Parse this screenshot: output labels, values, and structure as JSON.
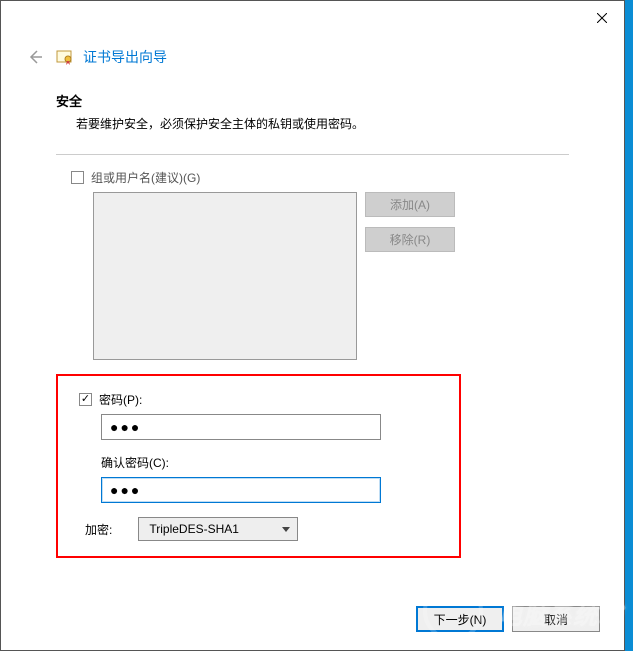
{
  "window": {
    "wizard_title": "证书导出向导"
  },
  "security": {
    "title": "安全",
    "description": "若要维护安全，必须保护安全主体的私钥或使用密码。"
  },
  "group": {
    "checkbox_label": "组或用户名(建议)(G)",
    "add_btn": "添加(A)",
    "remove_btn": "移除(R)"
  },
  "password": {
    "checkbox_label": "密码(P):",
    "value": "●●●",
    "confirm_label": "确认密码(C):",
    "confirm_value": "●●●"
  },
  "encryption": {
    "label": "加密:",
    "selected": "TripleDES-SHA1"
  },
  "footer": {
    "next": "下一步(N)",
    "cancel": "取消"
  },
  "watermark": {
    "text": "电脑系统城"
  }
}
